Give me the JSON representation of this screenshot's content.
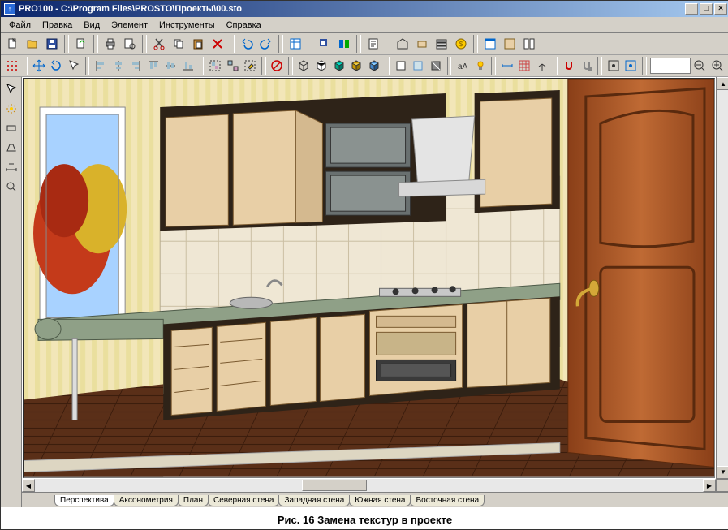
{
  "app": {
    "title": "PRO100 - C:\\Program Files\\PROSTO\\Проекты\\00.sto"
  },
  "menu": [
    "Файл",
    "Правка",
    "Вид",
    "Элемент",
    "Инструменты",
    "Справка"
  ],
  "tabs": [
    "Перспектива",
    "Аксонометрия",
    "План",
    "Северная стена",
    "Западная стена",
    "Южная стена",
    "Восточная стена"
  ],
  "active_tab_index": 0,
  "caption": "Рис. 16  Замена текстур  в проекте",
  "colors": {
    "wood_light": "#e8cfa6",
    "wood_dark": "#2e2318",
    "door_wood": "#a85a2a",
    "floor": "#5a2f18",
    "wall": "#f2e6b8",
    "tile": "#efe7d4",
    "counter": "#8fa087"
  }
}
